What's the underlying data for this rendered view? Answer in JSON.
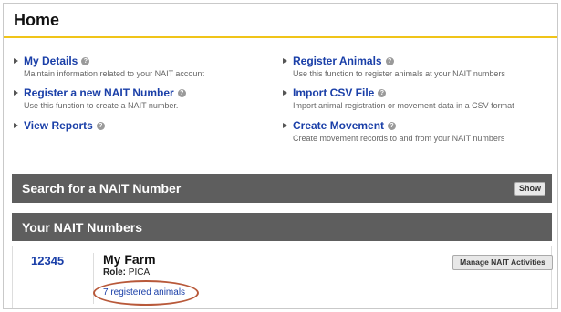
{
  "page": {
    "title": "Home"
  },
  "links": [
    {
      "label": "My Details",
      "desc": "Maintain information related to your NAIT account",
      "icon": "help-icon"
    },
    {
      "label": "Register a new NAIT Number",
      "desc": "Use this function to create a NAIT number.",
      "icon": "help-icon"
    },
    {
      "label": "View Reports",
      "desc": "",
      "icon": "help-icon"
    },
    {
      "label": "Register Animals",
      "desc": "Use this function to register animals at your NAIT numbers",
      "icon": "help-icon"
    },
    {
      "label": "Import CSV File",
      "desc": "Import animal registration or movement data in a CSV format",
      "icon": "help-icon"
    },
    {
      "label": "Create Movement",
      "desc": "Create movement records to and from your NAIT numbers",
      "icon": "help-icon"
    }
  ],
  "search": {
    "title": "Search for a NAIT Number",
    "show_label": "Show"
  },
  "numbers": {
    "title": "Your NAIT Numbers",
    "rows": [
      {
        "number": "12345",
        "farm": "My Farm",
        "role_label": "Role:",
        "role": "PICA",
        "animals": "7 registered animals",
        "manage_label": "Manage NAIT Activities"
      }
    ]
  },
  "colors": {
    "link": "#1a3fa8",
    "accent": "#f0c419",
    "bar": "#5e5e5e",
    "highlight_circle": "#b8593a"
  }
}
